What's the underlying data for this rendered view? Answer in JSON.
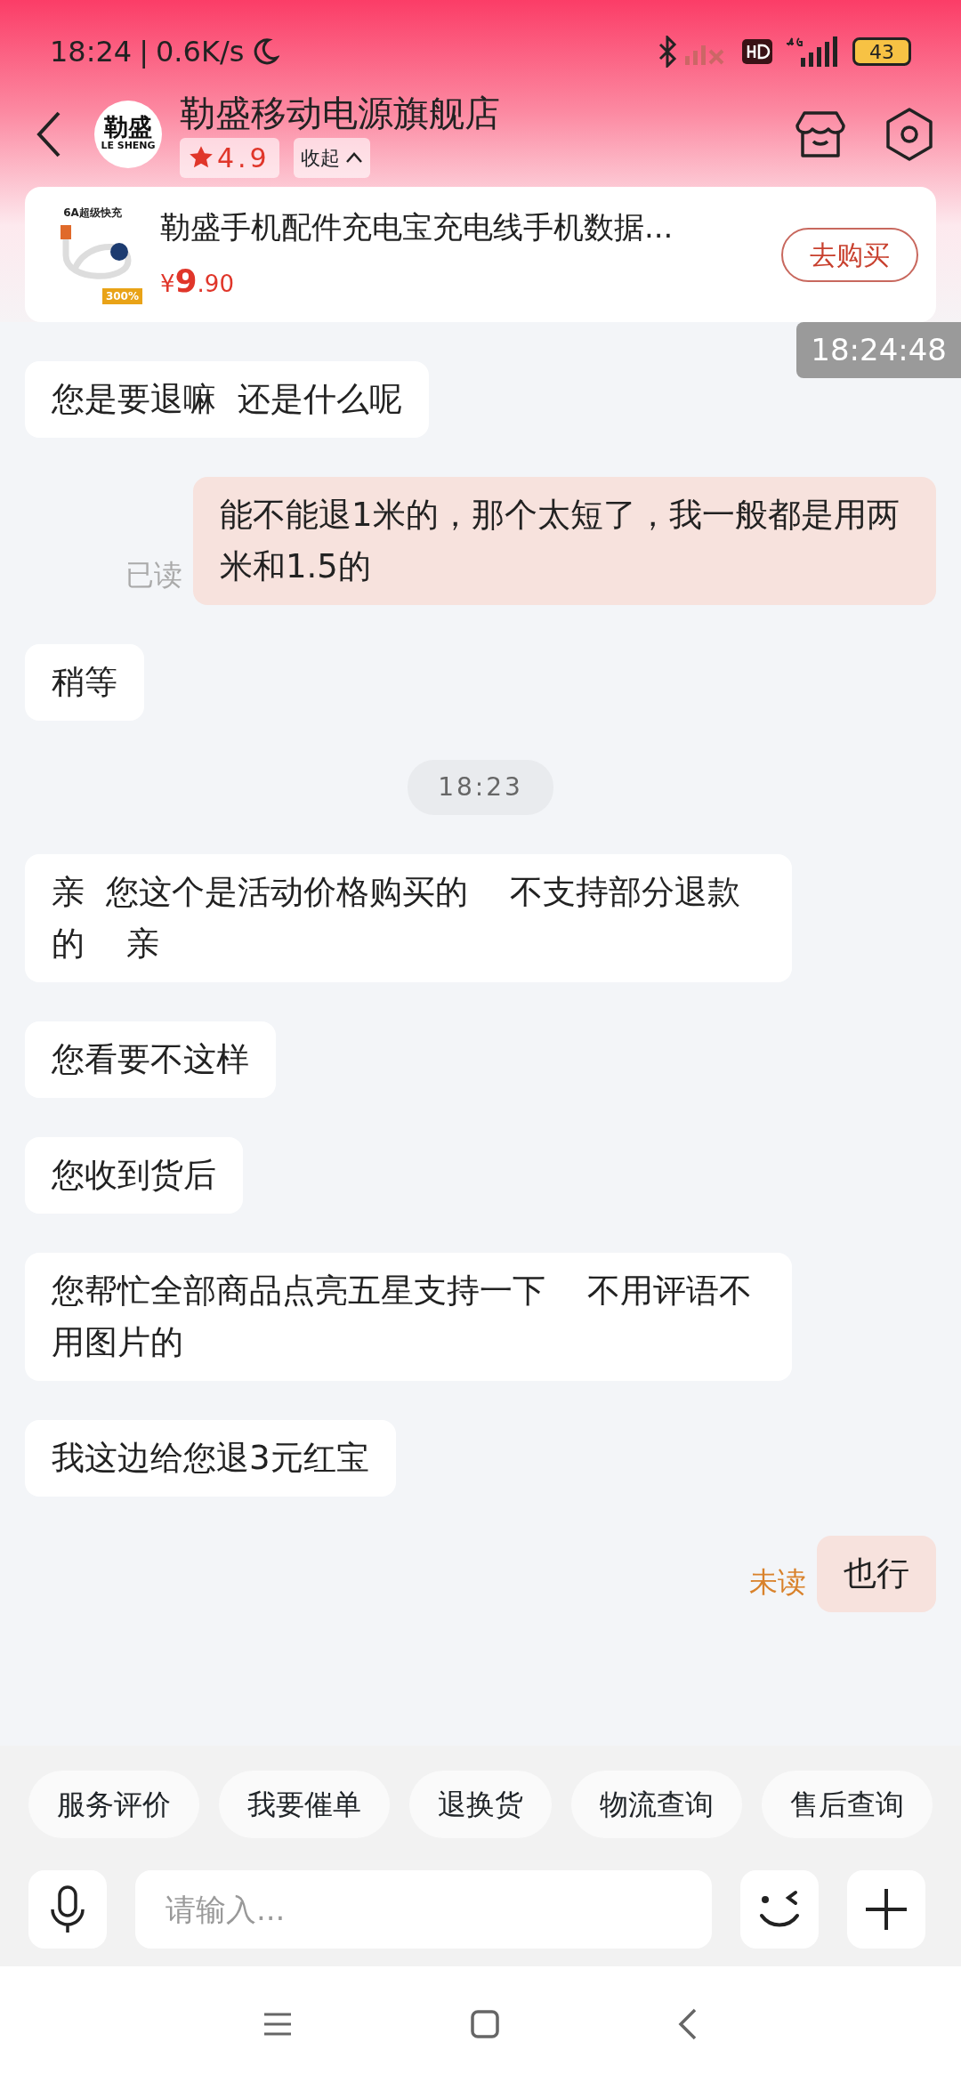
{
  "status_bar": {
    "time": "18:24",
    "divider": "|",
    "speed": "0.6K/s",
    "battery": "43"
  },
  "header": {
    "title": "勒盛移动电源旗舰店",
    "logo_text": "勒盛",
    "logo_sub": "LE SHENG",
    "rating": "4.9",
    "collapse": "收起"
  },
  "product": {
    "title": "勒盛手机配件充电宝充电线手机数据...",
    "currency": "¥",
    "price_int": "9",
    "price_dec": ".90",
    "buy": "去购买",
    "image_tag": "6A超级快充",
    "image_badge": "300%"
  },
  "scroll_time": "18:24:48",
  "messages": [
    {
      "kind": "left",
      "text": "您是要退嘛  还是什么呢"
    },
    {
      "kind": "right",
      "text": "能不能退1米的，那个太短了，我一般都是用两米和1.5的",
      "status": "已读",
      "read": true
    },
    {
      "kind": "left",
      "text": "稍等"
    },
    {
      "kind": "time",
      "text": "18:23"
    },
    {
      "kind": "left",
      "text": "亲  您这个是活动价格购买的    不支持部分退款的    亲"
    },
    {
      "kind": "left",
      "text": "您看要不这样"
    },
    {
      "kind": "left",
      "text": "您收到货后"
    },
    {
      "kind": "left",
      "text": "您帮忙全部商品点亮五星支持一下    不用评语不用图片的"
    },
    {
      "kind": "left",
      "text": "我这边给您退3元红宝"
    },
    {
      "kind": "right",
      "text": "也行",
      "status": "未读",
      "read": false
    }
  ],
  "quick_actions": [
    "服务评价",
    "我要催单",
    "退换货",
    "物流查询",
    "售后查询"
  ],
  "input": {
    "placeholder": "请输入..."
  }
}
